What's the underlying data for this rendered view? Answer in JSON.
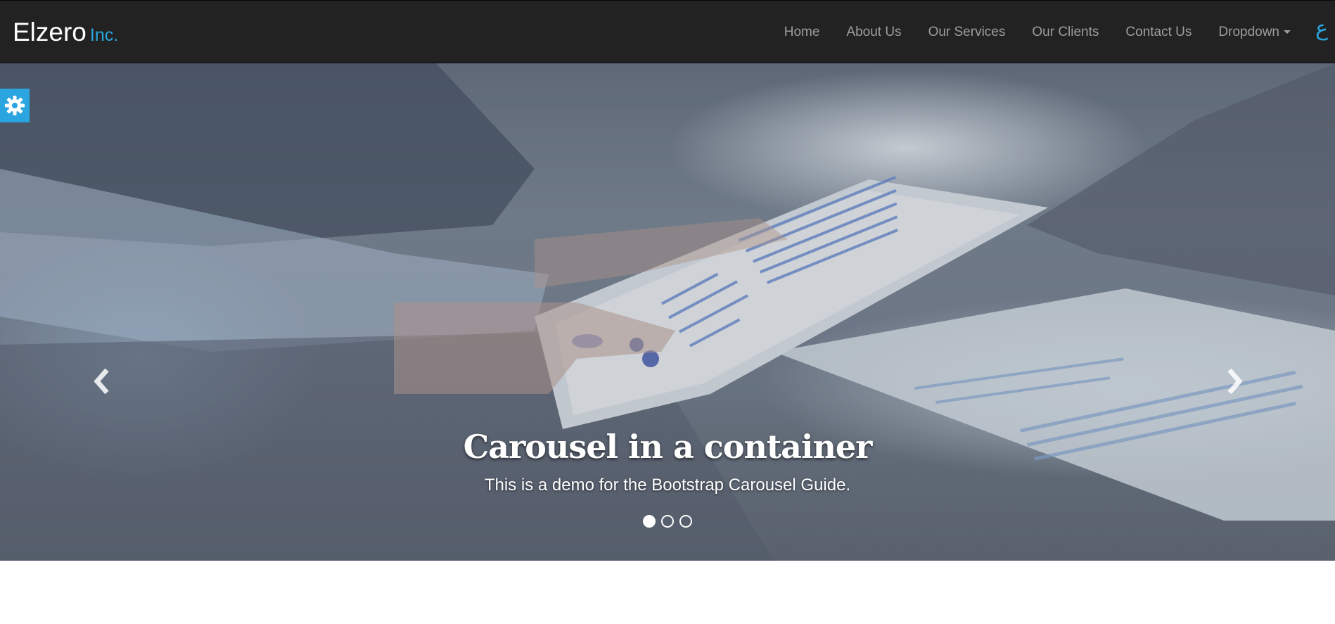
{
  "brand": {
    "name": "Elzero",
    "suffix": "Inc."
  },
  "nav": {
    "items": [
      "Home",
      "About Us",
      "Our Services",
      "Our Clients",
      "Contact Us"
    ],
    "dropdown_label": "Dropdown",
    "language_label": "ع"
  },
  "carousel": {
    "title": "Carousel in a container",
    "text": "This is a demo for the Bootstrap Carousel Guide.",
    "slide_count": 3,
    "active_slide": 1
  },
  "colors": {
    "navbar_bg": "#222222",
    "accent": "#2aa5df",
    "nav_text": "#9d9d9d"
  },
  "icons": {
    "settings": "gear-icon",
    "prev": "chevron-left-icon",
    "next": "chevron-right-icon"
  }
}
